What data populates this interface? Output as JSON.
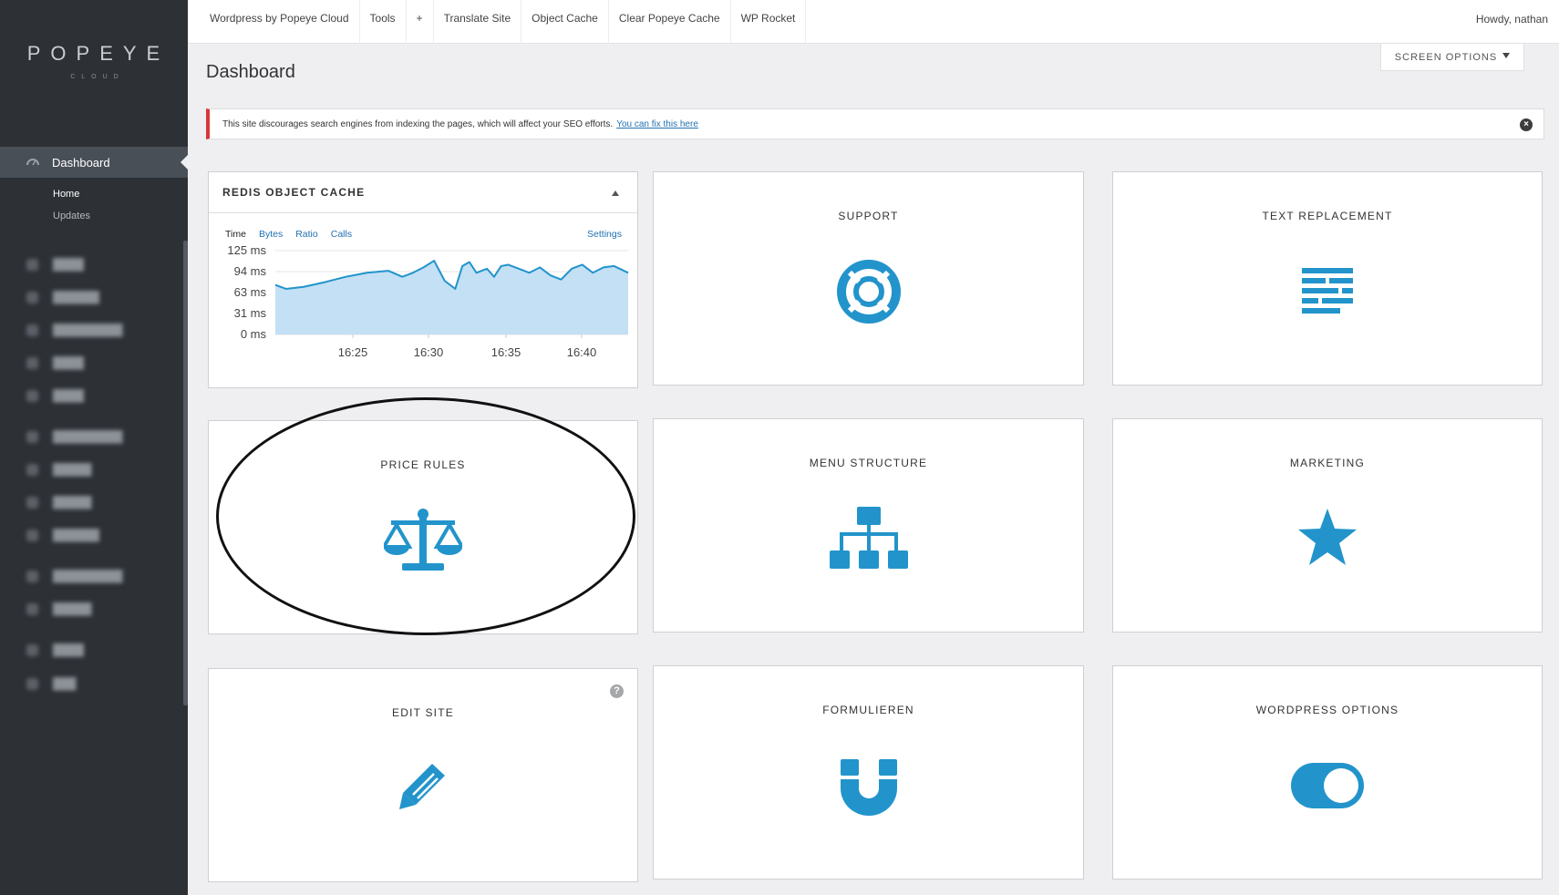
{
  "brand": {
    "name": "POPEYE",
    "tagline": "CLOUD"
  },
  "colors": {
    "accent": "#2294cb",
    "sidebar": "#2d3136",
    "notice_border": "#d63638",
    "link": "#2271b1"
  },
  "sidebar": {
    "active": {
      "label": "Dashboard",
      "icon": "dashboard-gauge-icon"
    },
    "sub": [
      {
        "label": "Home"
      },
      {
        "label": "Updates"
      }
    ]
  },
  "topbar": {
    "items": [
      {
        "label": "Wordpress by Popeye Cloud"
      },
      {
        "label": "Tools"
      },
      {
        "label": "+"
      },
      {
        "label": "Translate Site"
      },
      {
        "label": "Object Cache"
      },
      {
        "label": "Clear Popeye Cache"
      },
      {
        "label": "WP Rocket"
      }
    ],
    "howdy": "Howdy, nathan"
  },
  "screen_options": "SCREEN OPTIONS",
  "page_title": "Dashboard",
  "notice": {
    "text": "This site discourages search engines from indexing the pages, which will affect your SEO efforts.",
    "link": "You can fix this here"
  },
  "redis": {
    "title": "REDIS OBJECT CACHE",
    "tabs": [
      "Time",
      "Bytes",
      "Ratio",
      "Calls"
    ],
    "settings": "Settings"
  },
  "chart_data": {
    "type": "area",
    "title": "",
    "xlabel": "",
    "ylabel": "",
    "y_ticks": [
      "125 ms",
      "94 ms",
      "63 ms",
      "31 ms",
      "0 ms"
    ],
    "x_ticks": [
      "16:25",
      "16:30",
      "16:35",
      "16:40"
    ],
    "ylim": [
      0,
      125
    ],
    "xlim": [
      0,
      100
    ],
    "fill": "#c3e0f5",
    "stroke": "#2294cb",
    "x": [
      0,
      3,
      8,
      14,
      20,
      26,
      32,
      36,
      39,
      42,
      45,
      48,
      51,
      53,
      55,
      57,
      60,
      62,
      64,
      66,
      69,
      72,
      75,
      78,
      81,
      84,
      87,
      90,
      93,
      96,
      100
    ],
    "values": [
      74,
      68,
      71,
      78,
      86,
      92,
      95,
      86,
      92,
      100,
      110,
      80,
      68,
      102,
      108,
      92,
      98,
      86,
      102,
      104,
      98,
      92,
      100,
      88,
      82,
      98,
      104,
      92,
      100,
      102,
      92
    ]
  },
  "cards": {
    "support": {
      "title": "SUPPORT",
      "icon": "lifebuoy-icon"
    },
    "text_replacement": {
      "title": "TEXT REPLACEMENT",
      "icon": "text-align-icon"
    },
    "price_rules": {
      "title": "PRICE RULES",
      "icon": "balance-scale-icon"
    },
    "menu_structure": {
      "title": "MENU STRUCTURE",
      "icon": "sitemap-icon"
    },
    "marketing": {
      "title": "MARKETING",
      "icon": "star-icon"
    },
    "edit_site": {
      "title": "EDIT SITE",
      "icon": "pencil-icon",
      "help": "?"
    },
    "formulieren": {
      "title": "FORMULIEREN",
      "icon": "magnet-icon"
    },
    "wordpress_options": {
      "title": "WORDPRESS OPTIONS",
      "icon": "toggle-on-icon"
    }
  }
}
